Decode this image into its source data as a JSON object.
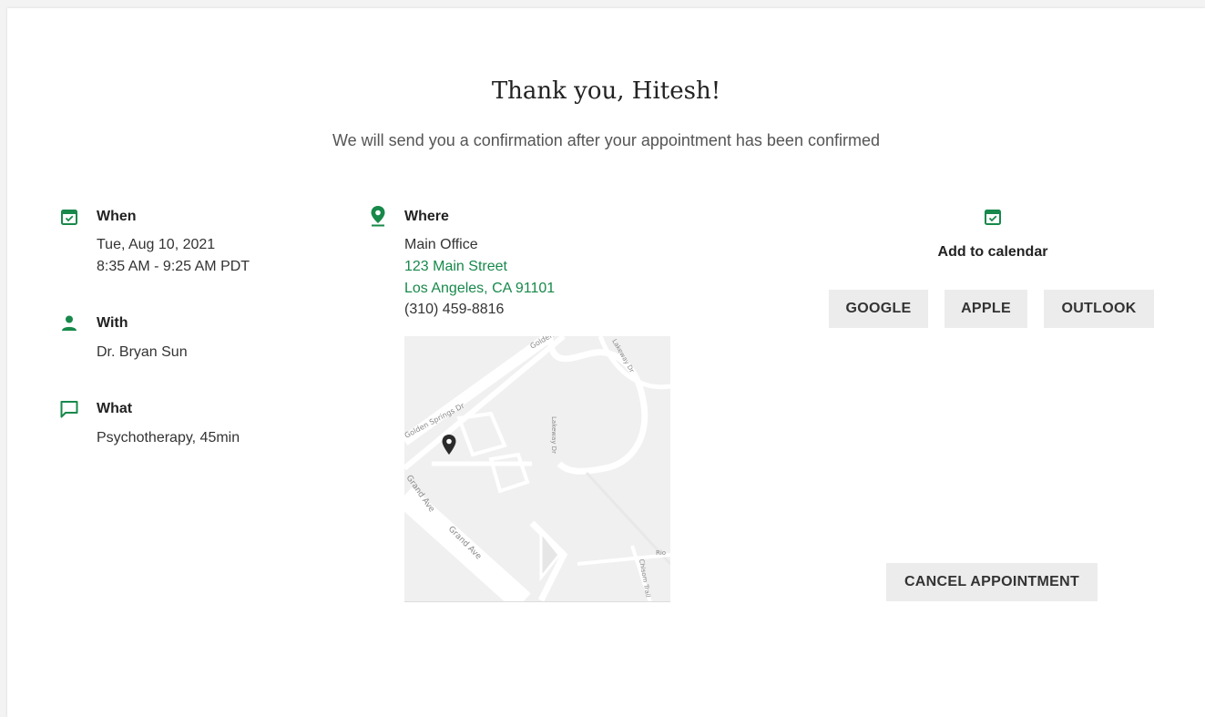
{
  "header": {
    "title": "Thank you, Hitesh!",
    "subtitle": "We will send you a confirmation after your appointment has been confirmed"
  },
  "when": {
    "label": "When",
    "date": "Tue, Aug 10, 2021",
    "time": "8:35 AM - 9:25 AM PDT",
    "icon": "calendar-check-icon"
  },
  "with": {
    "label": "With",
    "provider": "Dr. Bryan Sun",
    "icon": "person-icon"
  },
  "what": {
    "label": "What",
    "service": "Psychotherapy, 45min",
    "icon": "chat-bubble-icon"
  },
  "where": {
    "label": "Where",
    "name": "Main Office",
    "street": "123 Main Street",
    "city": "Los Angeles, CA 91101",
    "phone": "(310) 459-8816",
    "icon": "map-pin-icon"
  },
  "map": {
    "streets": [
      "Golden Springs Dr",
      "Golden Springs Dr",
      "Lakeway Dr",
      "Lakeway Dr",
      "Grand Ave",
      "Grand Ave",
      "Chisom Trail",
      "Rio"
    ]
  },
  "calendar": {
    "label": "Add to calendar",
    "icon": "calendar-check-icon",
    "buttons": [
      "GOOGLE",
      "APPLE",
      "OUTLOOK"
    ]
  },
  "actions": {
    "cancel_label": "CANCEL APPOINTMENT"
  },
  "colors": {
    "accent": "#17894a",
    "button_bg": "#ececec",
    "map_bg": "#f0f0f0"
  }
}
